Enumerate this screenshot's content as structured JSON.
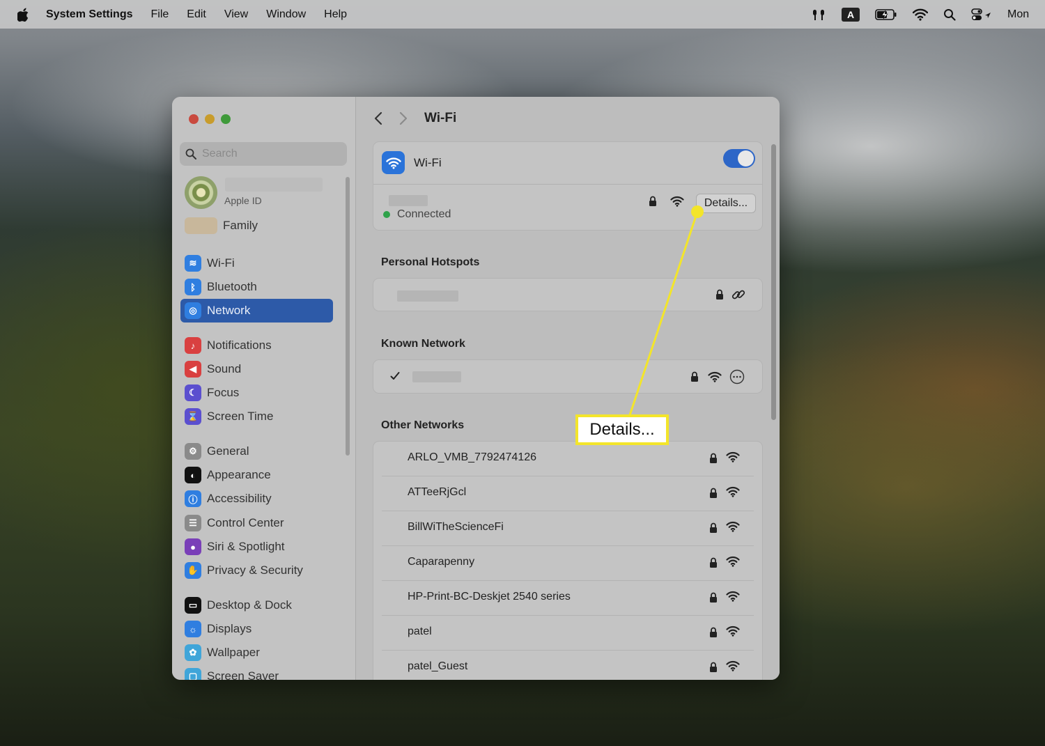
{
  "menubar": {
    "app_name": "System Settings",
    "menus": [
      "File",
      "Edit",
      "View",
      "Window",
      "Help"
    ],
    "clock_partial": "Mon"
  },
  "sidebar": {
    "search_placeholder": "Search",
    "apple_id_label": "Apple ID",
    "family_label": "Family",
    "items": [
      {
        "label": "Wi-Fi",
        "icon": "wifi-icon",
        "color": "#2f7ee0"
      },
      {
        "label": "Bluetooth",
        "icon": "bluetooth-icon",
        "color": "#2f7ee0"
      },
      {
        "label": "Network",
        "icon": "globe-icon",
        "color": "#2f7ee0",
        "selected": true
      },
      {
        "label": "Notifications",
        "icon": "bell-icon",
        "color": "#d94040"
      },
      {
        "label": "Sound",
        "icon": "speaker-icon",
        "color": "#d94040"
      },
      {
        "label": "Focus",
        "icon": "moon-icon",
        "color": "#5b4fcf"
      },
      {
        "label": "Screen Time",
        "icon": "hourglass-icon",
        "color": "#5b4fcf"
      },
      {
        "label": "General",
        "icon": "gear-icon",
        "color": "#8a8a8a"
      },
      {
        "label": "Appearance",
        "icon": "appearance-icon",
        "color": "#111111"
      },
      {
        "label": "Accessibility",
        "icon": "accessibility-icon",
        "color": "#2f7ee0"
      },
      {
        "label": "Control Center",
        "icon": "control-center-icon",
        "color": "#8a8a8a"
      },
      {
        "label": "Siri & Spotlight",
        "icon": "siri-icon",
        "color": "#7a3fb8"
      },
      {
        "label": "Privacy & Security",
        "icon": "hand-icon",
        "color": "#2f7ee0"
      },
      {
        "label": "Desktop & Dock",
        "icon": "dock-icon",
        "color": "#111111"
      },
      {
        "label": "Displays",
        "icon": "sun-icon",
        "color": "#2f7ee0"
      },
      {
        "label": "Wallpaper",
        "icon": "flower-icon",
        "color": "#3fa5d9"
      },
      {
        "label": "Screen Saver",
        "icon": "screensaver-icon",
        "color": "#3fa5d9"
      }
    ]
  },
  "main": {
    "title": "Wi-Fi",
    "wifi_label": "Wi-Fi",
    "wifi_enabled": true,
    "connected_label": "Connected",
    "details_label": "Details...",
    "personal_hotspots_title": "Personal Hotspots",
    "known_network_title": "Known Network",
    "other_networks_title": "Other Networks",
    "other_networks": [
      {
        "name": "ARLO_VMB_7792474126"
      },
      {
        "name": "ATTeeRjGcl"
      },
      {
        "name": "BillWiTheScienceFi"
      },
      {
        "name": "Caparapenny"
      },
      {
        "name": "HP-Print-BC-Deskjet 2540 series"
      },
      {
        "name": "patel"
      },
      {
        "name": "patel_Guest"
      }
    ]
  },
  "annotation": {
    "label": "Details...",
    "color": "#f3e52a"
  }
}
